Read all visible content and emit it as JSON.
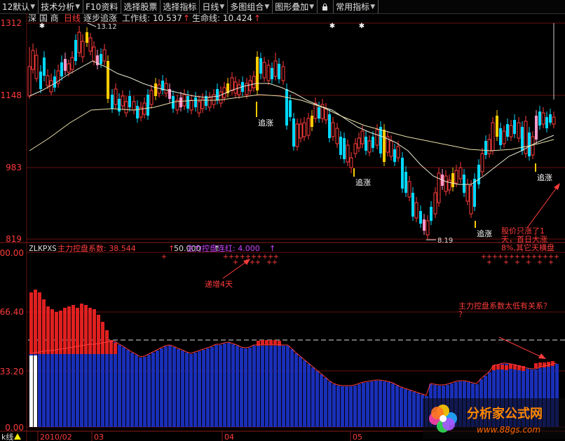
{
  "toolbar": {
    "items": [
      {
        "label": "12默认",
        "arrow": true
      },
      {
        "label": "技术分析",
        "arrow": true
      },
      {
        "label": "F10资料",
        "arrow": false
      },
      {
        "label": "选择股票",
        "arrow": false
      },
      {
        "label": "选择指标",
        "arrow": false
      },
      {
        "label": "日线",
        "arrow": true
      },
      {
        "label": "多图组合",
        "arrow": true
      },
      {
        "label": "图形叠加",
        "arrow": true
      },
      {
        "label": "",
        "icon": "lock-icon"
      },
      {
        "label": "常用指标",
        "arrow": true
      }
    ]
  },
  "main_chart": {
    "header": {
      "stock": "深 国 商",
      "period": "日线",
      "indicator": "逐步追涨",
      "work_line": "工作线: 10.537",
      "life_line": "生命线: 10.424"
    },
    "high_label": "13.12",
    "low_label": "8.19",
    "annotations": [
      "追涨",
      "追涨",
      "追涨",
      "追涨"
    ],
    "note": [
      "股价只涨了1",
      "天，首日大涨",
      "8%,其它天横盘"
    ],
    "y_axis": {
      "ticks": [
        "1312",
        "1148",
        "983",
        "819"
      ],
      "min": 819,
      "max": 1312
    }
  },
  "sub_chart": {
    "header": {
      "name": "ZLKPXS",
      "coef": "主力控盘系数: 38.544",
      "level": "50.000",
      "streak": "主力控盘连红: 4.000"
    },
    "label_increase": "递增4天",
    "question": [
      "主力控盘系数太低有关系？",
      "？"
    ],
    "y_axis": {
      "ticks": [
        "100.00",
        "66.40",
        "33.20",
        "0.00"
      ]
    }
  },
  "x_axis": {
    "labels": [
      "2010/02",
      "03",
      "04",
      "05"
    ]
  },
  "watermark": {
    "brand": "分析家公式网",
    "url": "www.88gs.com"
  },
  "bottom_tab": "k线",
  "colors": {
    "up": "#ff3c3c",
    "down": "#00d8ff",
    "ma": "#e8e8d0",
    "blue_bar": "#1a2fb8",
    "red_bar": "#e02020",
    "grid": "#6a1010"
  }
}
